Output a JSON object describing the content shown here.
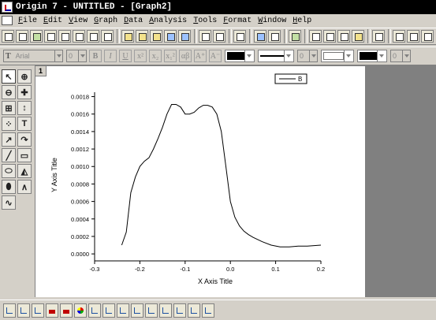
{
  "window": {
    "title": "Origin 7 - UNTITLED - [Graph2]"
  },
  "menu": [
    "File",
    "Edit",
    "View",
    "Graph",
    "Data",
    "Analysis",
    "Tools",
    "Format",
    "Window",
    "Help"
  ],
  "format_bar": {
    "font_name": "Arial",
    "font_size": "0",
    "bold": "B",
    "italic": "I",
    "underline": "U",
    "superscript": "x²",
    "subscript": "x₂",
    "sup_sub": "x₁²",
    "greek": "αβ",
    "increase_font": "A⁺",
    "decrease_font": "A⁻",
    "line_width": "0",
    "pattern_size": "0"
  },
  "graph": {
    "layer_number": "1"
  },
  "chart_data": {
    "type": "line",
    "title": "",
    "xlabel": "X Axis Title",
    "ylabel": "Y Axis Title",
    "xlim": [
      -0.3,
      0.2
    ],
    "ylim": [
      -8e-05,
      0.00185
    ],
    "xticks": [
      "-0.3",
      "-0.2",
      "-0.1",
      "0.0",
      "0.1",
      "0.2"
    ],
    "xtick_values": [
      -0.3,
      -0.2,
      -0.1,
      0.0,
      0.1,
      0.2
    ],
    "yticks": [
      "0.0000",
      "0.0002",
      "0.0004",
      "0.0006",
      "0.0008",
      "0.0010",
      "0.0012",
      "0.0014",
      "0.0016",
      "0.0018"
    ],
    "ytick_values": [
      0.0,
      0.0002,
      0.0004,
      0.0006,
      0.0008,
      0.001,
      0.0012,
      0.0014,
      0.0016,
      0.0018
    ],
    "legend": {
      "position": "top-right",
      "entries": [
        "B"
      ]
    },
    "series": [
      {
        "name": "B",
        "color": "#000000",
        "x": [
          -0.24,
          -0.23,
          -0.22,
          -0.21,
          -0.2,
          -0.19,
          -0.18,
          -0.17,
          -0.16,
          -0.15,
          -0.14,
          -0.13,
          -0.12,
          -0.11,
          -0.1,
          -0.09,
          -0.08,
          -0.07,
          -0.06,
          -0.05,
          -0.04,
          -0.03,
          -0.02,
          -0.01,
          0.0,
          0.01,
          0.02,
          0.03,
          0.04,
          0.05,
          0.07,
          0.09,
          0.11,
          0.13,
          0.15,
          0.17,
          0.2
        ],
        "y": [
          0.0001,
          0.00025,
          0.0007,
          0.00088,
          0.001,
          0.00106,
          0.0011,
          0.0012,
          0.00132,
          0.00145,
          0.0016,
          0.00171,
          0.00171,
          0.00168,
          0.0016,
          0.0016,
          0.00162,
          0.00167,
          0.0017,
          0.0017,
          0.00168,
          0.0016,
          0.0014,
          0.001,
          0.0006,
          0.00042,
          0.00032,
          0.00026,
          0.00022,
          0.00019,
          0.00014,
          0.0001,
          8e-05,
          8e-05,
          9e-05,
          9e-05,
          0.0001
        ]
      }
    ]
  }
}
